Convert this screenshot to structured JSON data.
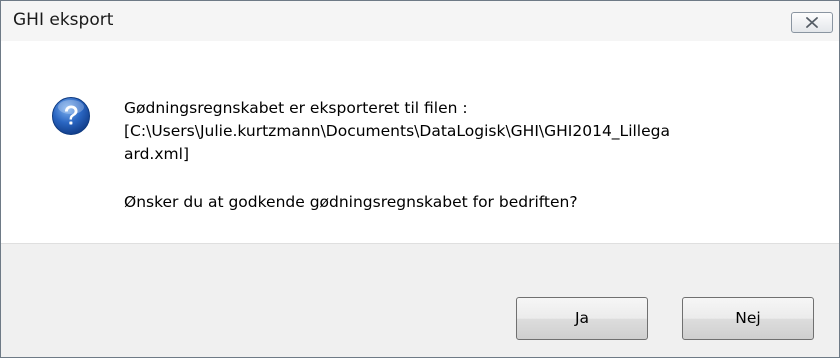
{
  "window": {
    "title": "GHI eksport"
  },
  "message": {
    "icon": "question-icon",
    "line1": "Gødningsregnskabet er eksporteret til filen :",
    "line2": "[C:\\Users\\Julie.kurtzmann\\Documents\\DataLogisk\\GHI\\GHI2014_Lillega",
    "line3": "ard.xml]",
    "question": "Ønsker du at godkende gødningsregnskabet for bedriften?"
  },
  "buttons": {
    "yes_label": "Ja",
    "no_label": "Nej"
  },
  "colors": {
    "icon_blue": "#1f5fb8",
    "content_bg": "#ffffff",
    "footer_bg": "#f0f0f0"
  }
}
